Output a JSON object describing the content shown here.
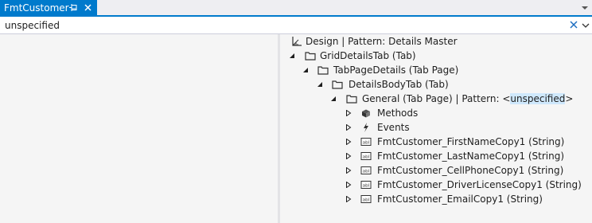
{
  "tab": {
    "title": "FmtCustomer"
  },
  "search": {
    "value": "unspecified"
  },
  "tree": {
    "root": {
      "label": "Design | Pattern: Details Master"
    },
    "grid_details_tab": {
      "label": "GridDetailsTab (Tab)"
    },
    "tab_page_details": {
      "label": "TabPageDetails (Tab Page)"
    },
    "details_body_tab": {
      "label": "DetailsBodyTab (Tab)"
    },
    "general": {
      "label_prefix": "General (Tab Page) | Pattern: <",
      "label_highlight": "unspecified",
      "label_suffix": ">"
    },
    "methods": {
      "label": "Methods"
    },
    "events": {
      "label": "Events"
    },
    "fields": [
      "FmtCustomer_FirstNameCopy1 (String)",
      "FmtCustomer_LastNameCopy1 (String)",
      "FmtCustomer_CellPhoneCopy1 (String)",
      "FmtCustomer_DriverLicenseCopy1 (String)",
      "FmtCustomer_EmailCopy1 (String)"
    ]
  },
  "icons": {
    "pin": "pin-icon",
    "close": "close-icon",
    "overflow": "overflow-dropdown-icon",
    "clear": "clear-search-icon",
    "dropdown": "search-dropdown-icon",
    "design": "design-icon",
    "folder": "folder-icon",
    "methods": "methods-icon",
    "events": "events-icon",
    "string": "string-field-icon"
  },
  "colors": {
    "accent": "#007acc",
    "highlight": "#cfe8fc"
  }
}
